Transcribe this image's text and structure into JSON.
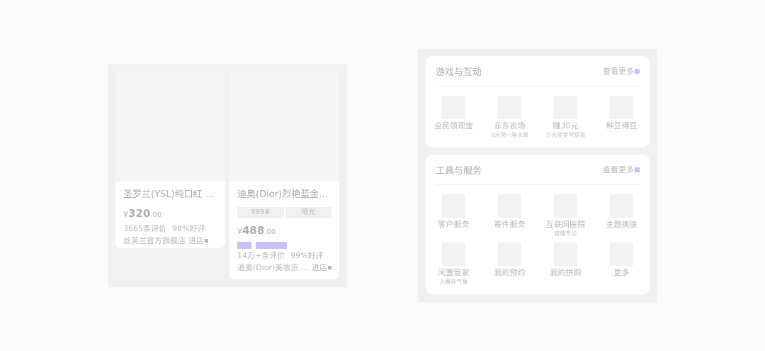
{
  "products": [
    {
      "title": "圣罗兰(YSL)纯口红 1...",
      "price_symbol": "¥",
      "price_int": "320",
      "price_dec": ".00",
      "reviews": "3665条评价",
      "rating": "98%好评",
      "shop": "丝芙兰官方旗舰店",
      "enter_label": "进店"
    },
    {
      "title": "迪奥(Dior)烈艳蓝金唇...",
      "specs": [
        "999#",
        "哑光"
      ],
      "price_symbol": "¥",
      "price_int": "488",
      "price_dec": ".00",
      "reviews": "14万+条评价",
      "rating": "99%好评",
      "shop": "迪奥(Dior)美妆京 ...",
      "enter_label": "进店"
    }
  ],
  "sections": [
    {
      "title": "游戏与互动",
      "more_label": "查看更多",
      "items": [
        {
          "label": "全民领现金",
          "sub": ""
        },
        {
          "label": "东东农场",
          "sub": "0元领一箱水果"
        },
        {
          "label": "赚30元",
          "sub": "万元奖金可提现"
        },
        {
          "label": "种豆得豆",
          "sub": ""
        }
      ]
    },
    {
      "title": "工具与服务",
      "more_label": "查看更多",
      "items": [
        {
          "label": "客户服务",
          "sub": ""
        },
        {
          "label": "寄件服务",
          "sub": ""
        },
        {
          "label": "互联网医院",
          "sub": "疫情专诊"
        },
        {
          "label": "主题换肤",
          "sub": ""
        },
        {
          "label": "闲置管家",
          "sub": "入春新气象"
        },
        {
          "label": "我的预约",
          "sub": ""
        },
        {
          "label": "我的拼购",
          "sub": ""
        },
        {
          "label": "更多",
          "sub": ""
        }
      ]
    }
  ],
  "colors": {
    "accent": "#c5c2f5",
    "panel_bg": "#f0f0f0",
    "card_bg": "#ffffff",
    "placeholder": "#f2f2f2"
  }
}
